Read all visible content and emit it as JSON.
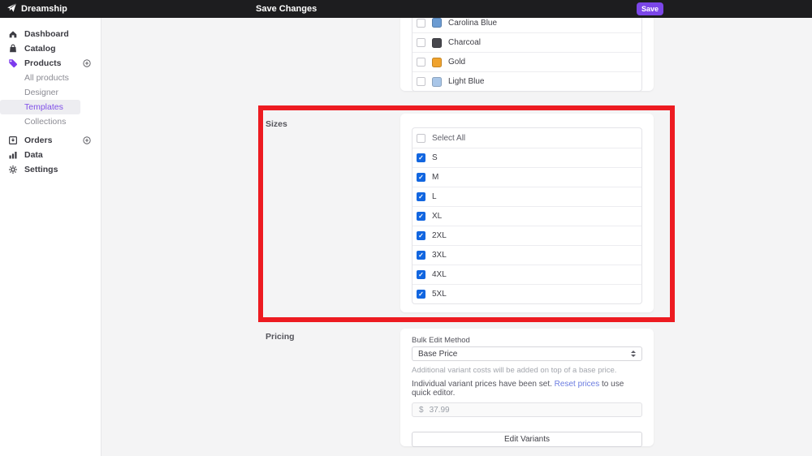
{
  "theme": {
    "topbar_bg": "#1d1d1f",
    "accent_purple": "#7b46e8",
    "sidebar_active": "#8050e8",
    "checkbox_blue": "#1266e0",
    "highlight_red": "#ed1b21"
  },
  "topbar": {
    "brand": "Dreamship",
    "title": "Save Changes",
    "save_label": "Save"
  },
  "sidebar": {
    "items": [
      {
        "label": "Dashboard",
        "icon": "home-icon",
        "type": "top"
      },
      {
        "label": "Catalog",
        "icon": "bag-icon",
        "type": "top"
      },
      {
        "label": "Products",
        "icon": "tag-icon",
        "type": "top",
        "plus": true
      },
      {
        "label": "All products",
        "type": "sub"
      },
      {
        "label": "Designer",
        "type": "sub"
      },
      {
        "label": "Templates",
        "type": "sub",
        "active": true
      },
      {
        "label": "Collections",
        "type": "sub"
      },
      {
        "label": "Orders",
        "icon": "inbox-icon",
        "type": "top",
        "plus": true,
        "gap": true
      },
      {
        "label": "Data",
        "icon": "chart-icon",
        "type": "top"
      },
      {
        "label": "Settings",
        "icon": "gear-icon",
        "type": "top"
      }
    ]
  },
  "colors_section": {
    "items": [
      {
        "label": "Carolina Blue",
        "swatch": "#6b9bd2",
        "checked": false
      },
      {
        "label": "Charcoal",
        "swatch": "#47474d",
        "checked": false
      },
      {
        "label": "Gold",
        "swatch": "#f0a32e",
        "checked": false
      },
      {
        "label": "Light Blue",
        "swatch": "#a9c6e8",
        "checked": false
      }
    ]
  },
  "sizes_section": {
    "label": "Sizes",
    "select_all_label": "Select All",
    "select_all_checked": false,
    "options": [
      {
        "label": "S",
        "checked": true
      },
      {
        "label": "M",
        "checked": true
      },
      {
        "label": "L",
        "checked": true
      },
      {
        "label": "XL",
        "checked": true
      },
      {
        "label": "2XL",
        "checked": true
      },
      {
        "label": "3XL",
        "checked": true
      },
      {
        "label": "4XL",
        "checked": true
      },
      {
        "label": "5XL",
        "checked": true
      }
    ]
  },
  "pricing_section": {
    "label": "Pricing",
    "bulk_edit_label": "Bulk Edit Method",
    "bulk_edit_value": "Base Price",
    "helper": "Additional variant costs will be added on top of a base price.",
    "notice_prefix": "Individual variant prices have been set.",
    "notice_link": "Reset prices",
    "notice_suffix": "to use quick editor.",
    "price_currency": "$",
    "price_value": "37.99",
    "edit_variants_label": "Edit Variants"
  }
}
